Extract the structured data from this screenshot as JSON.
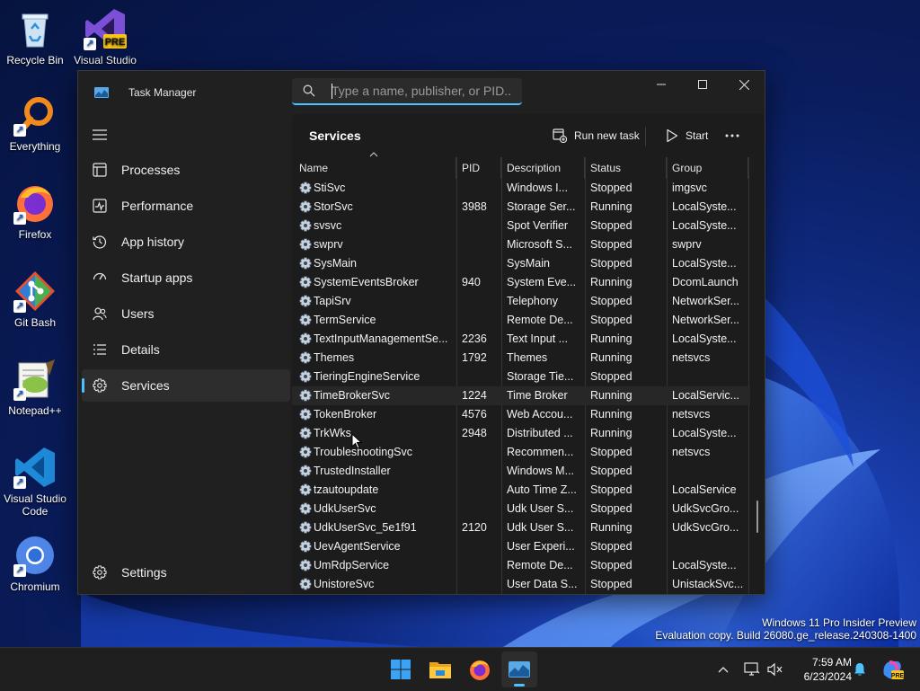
{
  "desktop": {
    "icons": [
      {
        "label": "Recycle Bin",
        "icon": "recycle-bin-icon"
      },
      {
        "label": "Visual Studio 2022 Preview",
        "icon": "visual-studio-preview-icon",
        "badge": "PRE"
      },
      {
        "label": "Everything",
        "icon": "everything-search-icon"
      },
      {
        "label": "Firefox",
        "icon": "firefox-icon"
      },
      {
        "label": "Git Bash",
        "icon": "git-bash-icon"
      },
      {
        "label": "Notepad++",
        "icon": "notepad-plus-plus-icon"
      },
      {
        "label": "Visual Studio Code",
        "icon": "vscode-icon"
      },
      {
        "label": "Chromium",
        "icon": "chromium-icon"
      }
    ],
    "watermark": {
      "line1": "Windows 11 Pro Insider Preview",
      "line2": "Evaluation copy. Build 26080.ge_release.240308-1400"
    }
  },
  "window": {
    "title": "Task Manager",
    "search": {
      "placeholder": "Type a name, publisher, or PID..."
    },
    "controls": [
      "minimize",
      "maximize",
      "close"
    ]
  },
  "sidebar": {
    "items": [
      {
        "label": "Processes",
        "icon": "processes-icon"
      },
      {
        "label": "Performance",
        "icon": "performance-icon"
      },
      {
        "label": "App history",
        "icon": "app-history-icon"
      },
      {
        "label": "Startup apps",
        "icon": "startup-apps-icon"
      },
      {
        "label": "Users",
        "icon": "users-icon"
      },
      {
        "label": "Details",
        "icon": "details-icon"
      },
      {
        "label": "Services",
        "icon": "services-icon",
        "active": true
      }
    ],
    "settings": {
      "label": "Settings",
      "icon": "gear-icon"
    }
  },
  "main": {
    "title": "Services",
    "commands": {
      "run_new_task": "Run new task",
      "start": "Start"
    },
    "columns": [
      "Name",
      "PID",
      "Description",
      "Status",
      "Group"
    ],
    "rows": [
      {
        "name": "StiSvc",
        "pid": "",
        "description": "Windows I...",
        "status": "Stopped",
        "group": "imgsvc"
      },
      {
        "name": "StorSvc",
        "pid": "3988",
        "description": "Storage Ser...",
        "status": "Running",
        "group": "LocalSyste..."
      },
      {
        "name": "svsvc",
        "pid": "",
        "description": "Spot Verifier",
        "status": "Stopped",
        "group": "LocalSyste..."
      },
      {
        "name": "swprv",
        "pid": "",
        "description": "Microsoft S...",
        "status": "Stopped",
        "group": "swprv"
      },
      {
        "name": "SysMain",
        "pid": "",
        "description": "SysMain",
        "status": "Stopped",
        "group": "LocalSyste..."
      },
      {
        "name": "SystemEventsBroker",
        "pid": "940",
        "description": "System Eve...",
        "status": "Running",
        "group": "DcomLaunch"
      },
      {
        "name": "TapiSrv",
        "pid": "",
        "description": "Telephony",
        "status": "Stopped",
        "group": "NetworkSer..."
      },
      {
        "name": "TermService",
        "pid": "",
        "description": "Remote De...",
        "status": "Stopped",
        "group": "NetworkSer..."
      },
      {
        "name": "TextInputManagementSe...",
        "pid": "2236",
        "description": "Text Input ...",
        "status": "Running",
        "group": "LocalSyste..."
      },
      {
        "name": "Themes",
        "pid": "1792",
        "description": "Themes",
        "status": "Running",
        "group": "netsvcs"
      },
      {
        "name": "TieringEngineService",
        "pid": "",
        "description": "Storage Tie...",
        "status": "Stopped",
        "group": ""
      },
      {
        "name": "TimeBrokerSvc",
        "pid": "1224",
        "description": "Time Broker",
        "status": "Running",
        "group": "LocalServic..."
      },
      {
        "name": "TokenBroker",
        "pid": "4576",
        "description": "Web Accou...",
        "status": "Running",
        "group": "netsvcs"
      },
      {
        "name": "TrkWks",
        "pid": "2948",
        "description": "Distributed ...",
        "status": "Running",
        "group": "LocalSyste..."
      },
      {
        "name": "TroubleshootingSvc",
        "pid": "",
        "description": "Recommen...",
        "status": "Stopped",
        "group": "netsvcs"
      },
      {
        "name": "TrustedInstaller",
        "pid": "",
        "description": "Windows M...",
        "status": "Stopped",
        "group": ""
      },
      {
        "name": "tzautoupdate",
        "pid": "",
        "description": "Auto Time Z...",
        "status": "Stopped",
        "group": "LocalService"
      },
      {
        "name": "UdkUserSvc",
        "pid": "",
        "description": "Udk User S...",
        "status": "Stopped",
        "group": "UdkSvcGro..."
      },
      {
        "name": "UdkUserSvc_5e1f91",
        "pid": "2120",
        "description": "Udk User S...",
        "status": "Running",
        "group": "UdkSvcGro..."
      },
      {
        "name": "UevAgentService",
        "pid": "",
        "description": "User Experi...",
        "status": "Stopped",
        "group": ""
      },
      {
        "name": "UmRdpService",
        "pid": "",
        "description": "Remote De...",
        "status": "Stopped",
        "group": "LocalSyste..."
      },
      {
        "name": "UnistoreSvc",
        "pid": "",
        "description": "User Data S...",
        "status": "Stopped",
        "group": "UnistackSvc..."
      }
    ]
  },
  "taskbar": {
    "apps": [
      "start-icon",
      "file-explorer-icon",
      "firefox-icon",
      "task-manager-icon"
    ],
    "clock": {
      "time": "7:59 AM",
      "date": "6/23/2024"
    },
    "tray": [
      "chevron-up-icon",
      "network-icon",
      "volume-muted-icon",
      "notification-bell-icon",
      "copilot-icon"
    ]
  },
  "colors": {
    "accent": "#4cc2ff",
    "window_bg": "#202020",
    "taskbar_bg": "#1f1f1f"
  }
}
